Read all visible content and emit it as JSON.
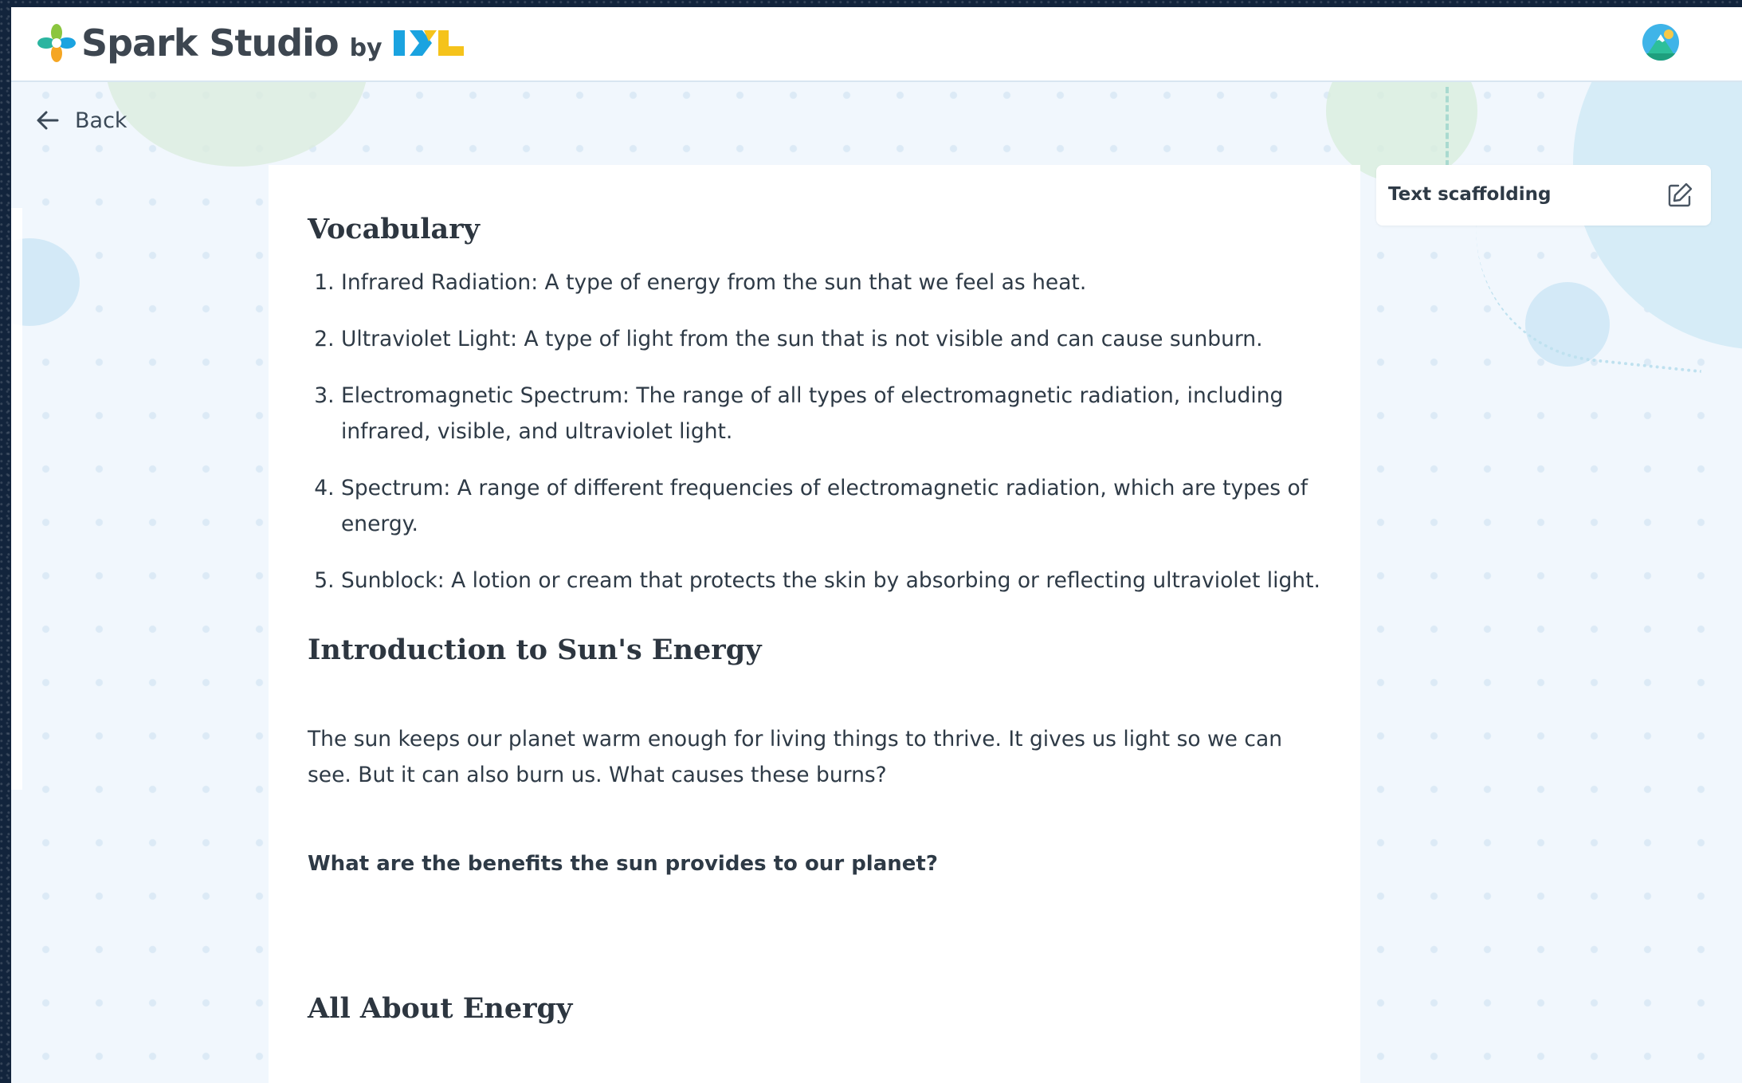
{
  "header": {
    "app_name": "Spark Studio",
    "by_label": "by",
    "partner_brand": "IXL"
  },
  "nav": {
    "back_label": "Back"
  },
  "sidebar": {
    "text_scaffolding_label": "Text scaffolding"
  },
  "document": {
    "vocabulary_heading": "Vocabulary",
    "vocabulary": [
      "Infrared Radiation: A type of energy from the sun that we feel as heat.",
      "Ultraviolet Light: A type of light from the sun that is not visible and can cause sunburn.",
      "Electromagnetic Spectrum: The range of all types of electromagnetic radiation, including infrared, visible, and ultraviolet light.",
      "Spectrum: A range of different frequencies of electromagnetic radiation, which are types of energy.",
      "Sunblock: A lotion or cream that protects the skin by absorbing or reflecting ultraviolet light."
    ],
    "intro_heading": "Introduction to Sun's Energy",
    "intro_paragraph": "The sun keeps our planet warm enough for living things to thrive. It gives us light so we can see. But it can also burn us. What causes these burns?",
    "intro_question": "What are the benefits the sun provides to our planet?",
    "energy_heading": "All About Energy"
  },
  "colors": {
    "page_bg": "#f1f7fd",
    "text": "#2e3a46",
    "ixl_blue": "#1aa3e0",
    "ixl_yellow": "#f5c31b"
  },
  "icons": {
    "logo": "spark-flower-icon",
    "back": "arrow-left-icon",
    "edit": "edit-pencil-icon",
    "avatar": "mountain-avatar-icon"
  }
}
